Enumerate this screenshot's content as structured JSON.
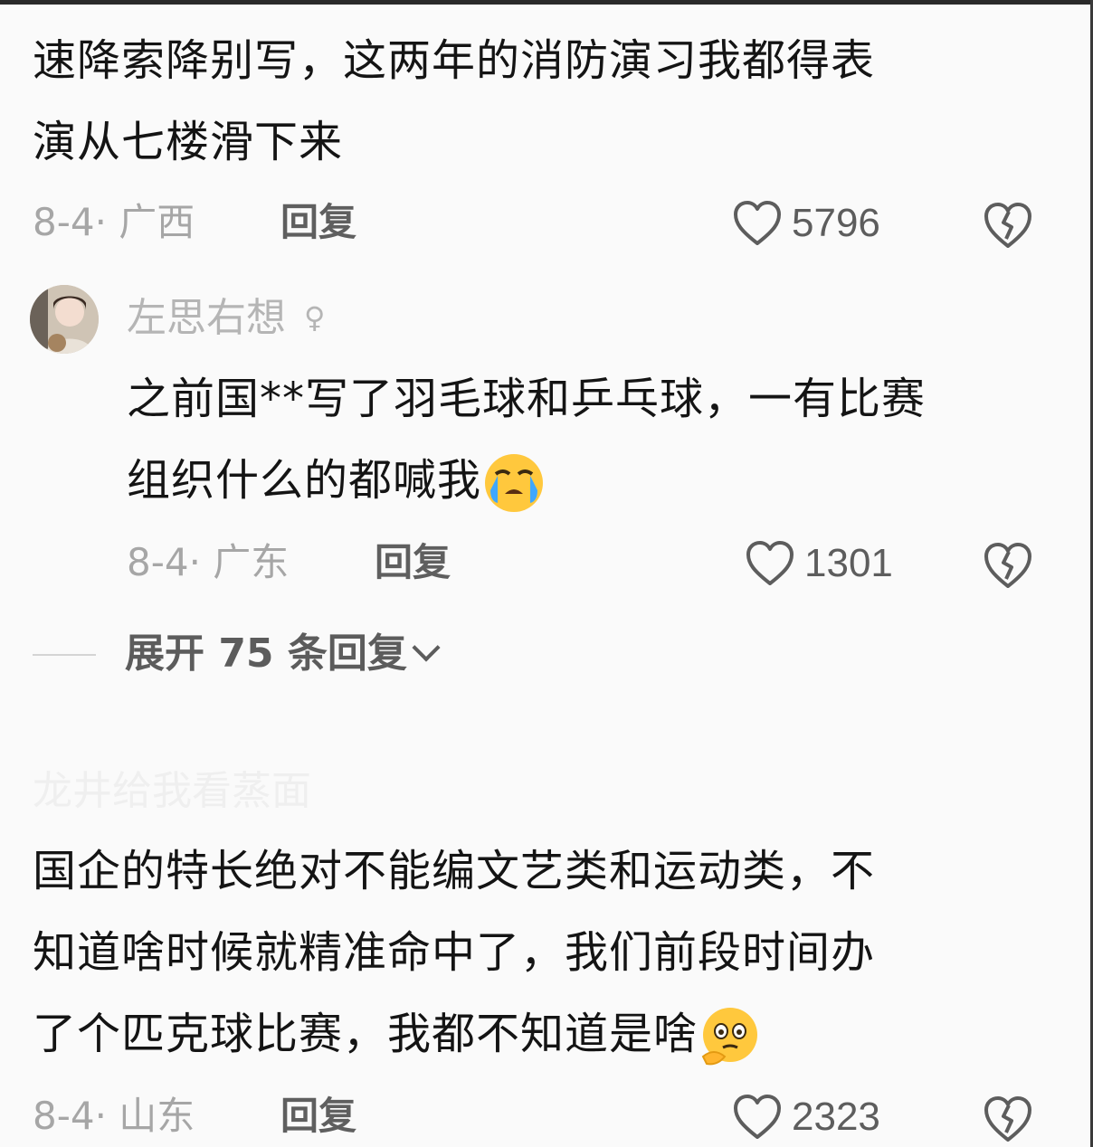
{
  "comments": [
    {
      "lines": [
        "速降索降别写，这两年的消防演习我都得表",
        "演从七楼滑下来"
      ],
      "when": "8-4· 广西",
      "reply": "回复",
      "likes": "5796"
    },
    {
      "user": "左思右想",
      "lines": [
        "之前国**写了羽毛球和乒乓球，一有比赛",
        "组织什么的都喊我"
      ],
      "emoji": "crying-face",
      "when": "8-4· 广东",
      "reply": "回复",
      "likes": "1301",
      "expand": "展开 75 条回复"
    },
    {
      "user": "龙井给我看蒸面",
      "lines": [
        "国企的特长绝对不能编文艺类和运动类，不",
        "知道啥时候就精准命中了，我们前段时间办",
        "了个匹克球比赛，我都不知道是啥"
      ],
      "emoji": "thinking-face",
      "when": "8-4· 山东",
      "reply": "回复",
      "likes": "2323"
    }
  ],
  "colors": {
    "text": "#141414",
    "meta": "#a6a6a6",
    "icon": "#5d5d5d",
    "background": "#fafafa"
  }
}
